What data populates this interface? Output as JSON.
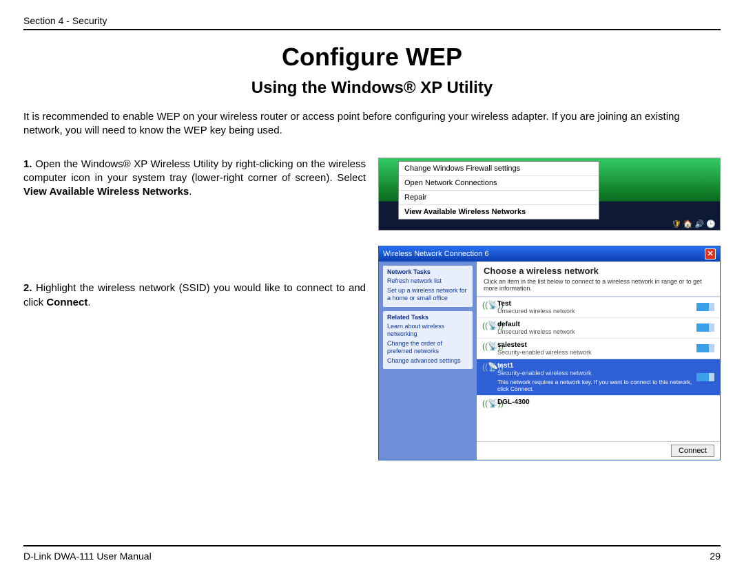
{
  "header": {
    "section": "Section 4 - Security"
  },
  "title": "Configure WEP",
  "subtitle": "Using the Windows® XP Utility",
  "intro": "It is recommended to enable WEP on your wireless router or access point before configuring your wireless adapter. If you are joining an existing network, you will need to know the WEP key being used.",
  "steps": {
    "s1": {
      "num": "1.",
      "pre": "Open the Windows® XP Wireless Utility by right-clicking on the wireless computer icon in your system tray (lower-right corner of screen). Select ",
      "bold": "View Available Wireless Networks",
      "post": "."
    },
    "s2": {
      "num": "2.",
      "pre": "Highlight the wireless network (SSID) you would like to connect to and click ",
      "bold": "Connect",
      "post": "."
    }
  },
  "context_menu": {
    "items": [
      "Change Windows Firewall settings",
      "Open Network Connections",
      "Repair",
      "View Available Wireless Networks"
    ]
  },
  "window": {
    "title": "Wireless Network Connection 6",
    "side": {
      "network_tasks": {
        "t": "Network Tasks",
        "items": [
          "Refresh network list",
          "Set up a wireless network for a home or small office"
        ]
      },
      "related_tasks": {
        "t": "Related Tasks",
        "items": [
          "Learn about wireless networking",
          "Change the order of preferred networks",
          "Change advanced settings"
        ]
      }
    },
    "choose": "Choose a wireless network",
    "desc": "Click an item in the list below to connect to a wireless network in range or to get more information.",
    "networks": [
      {
        "ssid": "Test",
        "type": "Unsecured wireless network"
      },
      {
        "ssid": "default",
        "type": "Unsecured wireless network"
      },
      {
        "ssid": "salestest",
        "type": "Security-enabled wireless network"
      },
      {
        "ssid": "test1",
        "type": "Security-enabled wireless network",
        "extra": "This network requires a network key. If you want to connect to this network, click Connect."
      },
      {
        "ssid": "DGL-4300",
        "type": ""
      }
    ],
    "connect": "Connect"
  },
  "footer": {
    "manual": "D-Link DWA-111 User Manual",
    "page": "29"
  }
}
